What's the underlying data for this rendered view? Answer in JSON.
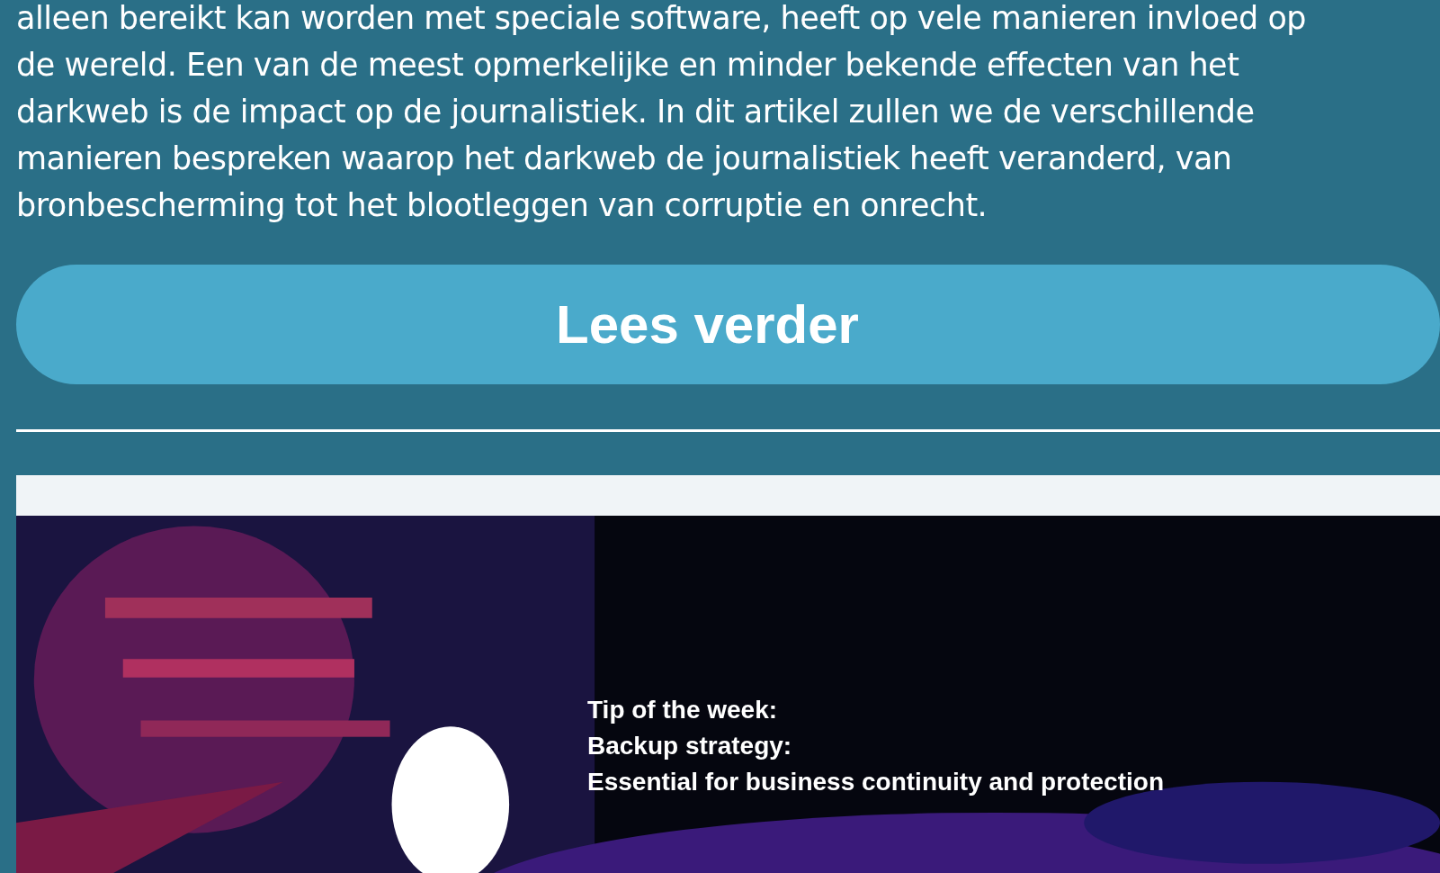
{
  "article": {
    "excerpt_lines": [
      "alleen bereikt kan worden met speciale software, heeft op vele manieren invloed op",
      "de wereld. Een van de meest opmerkelijke en minder bekende effecten van het",
      "darkweb is de impact op de journalistiek. In dit artikel zullen we de verschillende",
      "manieren bespreken waarop het darkweb de journalistiek heeft veranderd, van",
      "bronbescherming tot het blootleggen van corruptie en onrecht."
    ],
    "read_more": "Lees verder"
  },
  "banner": {
    "kind": "picture",
    "caption_lines": [
      "Tip of the week:",
      "Backup strategy:",
      "Essential for business continuity and protection"
    ]
  }
}
